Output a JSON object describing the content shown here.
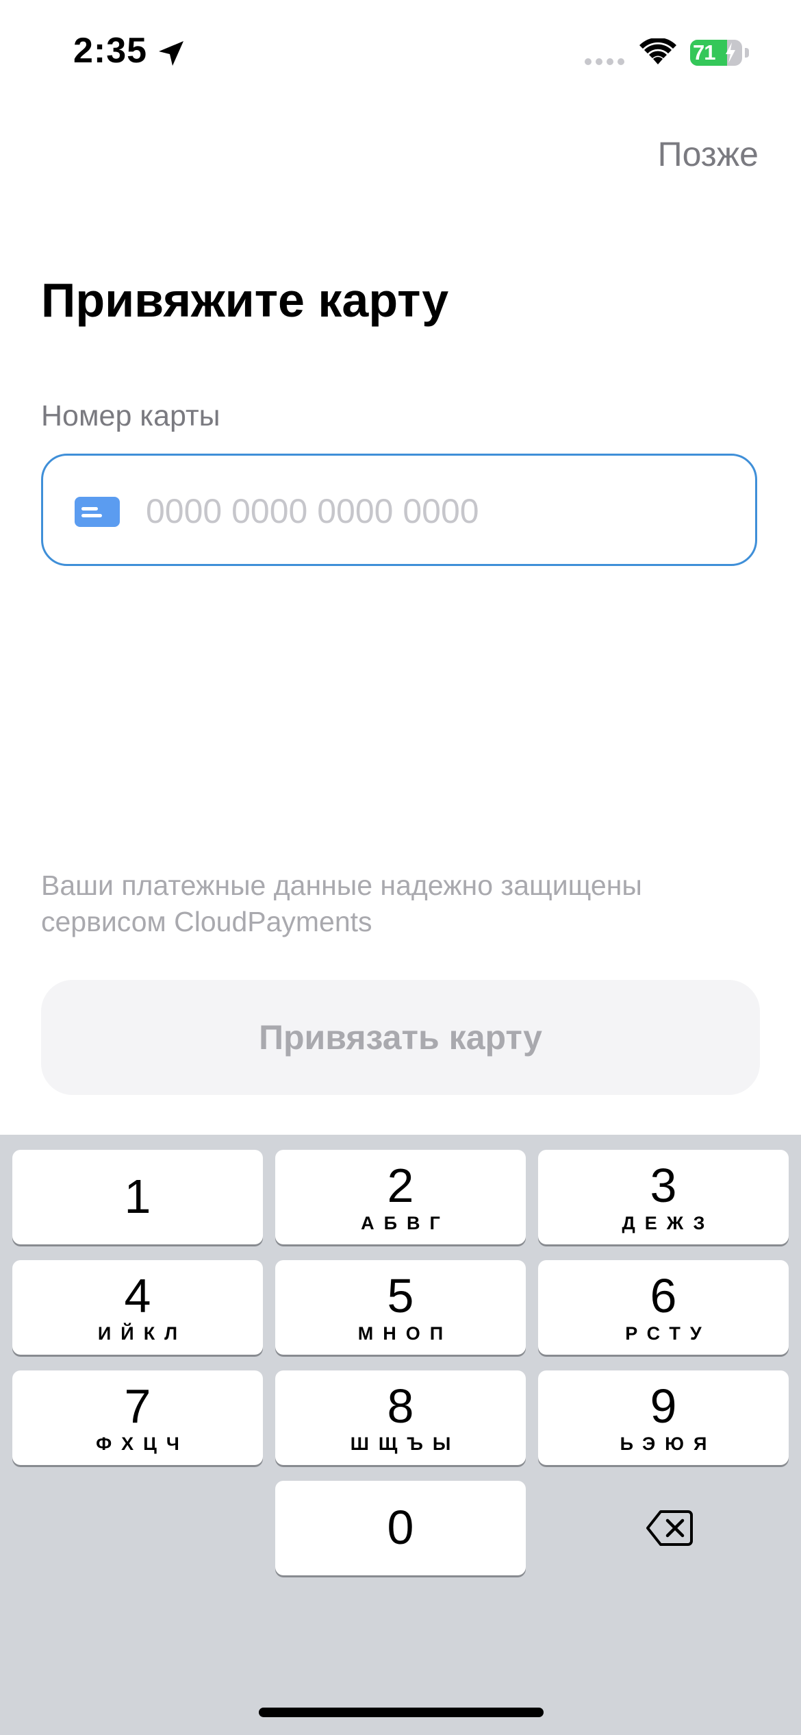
{
  "status_bar": {
    "time": "2:35",
    "battery_level": "71",
    "battery_fraction": 0.71,
    "battery_color": "#34c759",
    "icons": [
      "location-arrow-icon",
      "cellular-signal-icon",
      "wifi-icon",
      "battery-charging-icon"
    ]
  },
  "header": {
    "later_label": "Позже"
  },
  "main": {
    "title": "Привяжите карту",
    "card_field": {
      "label": "Номер карты",
      "value": "",
      "placeholder": "0000 0000 0000 0000",
      "icon": "credit-card-icon"
    },
    "security_note": "Ваши платежные данные надежно защищены сервисом CloudPayments",
    "submit_label": "Привязать карту"
  },
  "colors": {
    "accent": "#3f8fd8",
    "card_icon": "#5b9cf0",
    "disabled_button_bg": "#f4f4f6",
    "disabled_text": "#a9a9ae"
  },
  "keyboard": {
    "keys": [
      {
        "num": "1",
        "letters": ""
      },
      {
        "num": "2",
        "letters": "АБВГ"
      },
      {
        "num": "3",
        "letters": "ДЕЖЗ"
      },
      {
        "num": "4",
        "letters": "ИЙКЛ"
      },
      {
        "num": "5",
        "letters": "МНОП"
      },
      {
        "num": "6",
        "letters": "РСТУ"
      },
      {
        "num": "7",
        "letters": "ФХЦЧ"
      },
      {
        "num": "8",
        "letters": "ШЩЪЫ"
      },
      {
        "num": "9",
        "letters": "ЬЭЮЯ"
      },
      {
        "num": "0",
        "letters": ""
      }
    ],
    "delete_icon": "backspace-icon"
  }
}
